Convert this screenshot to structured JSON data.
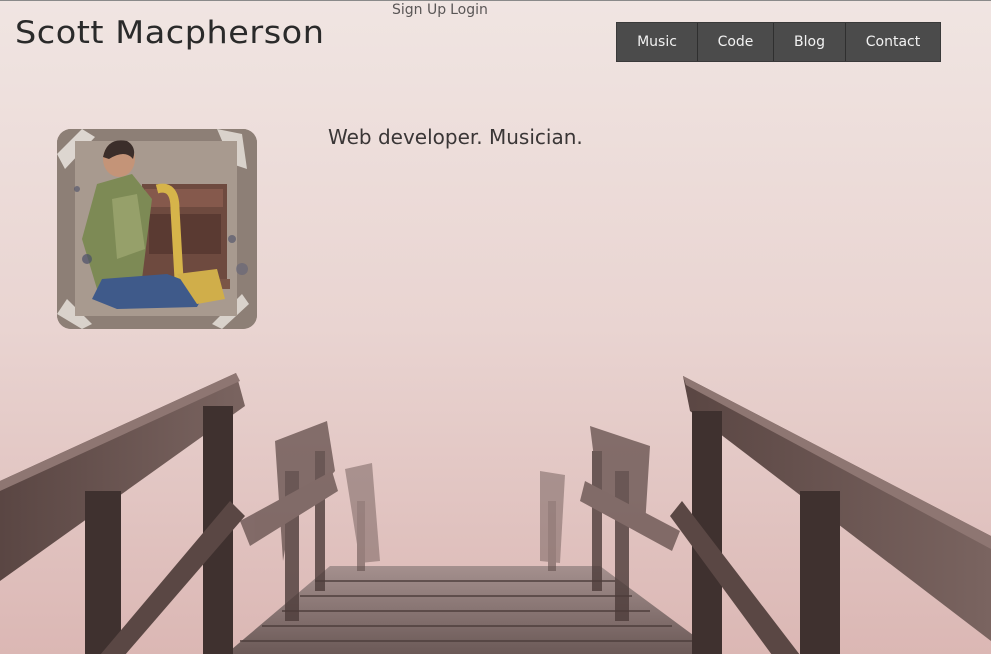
{
  "header": {
    "site_title": "Scott Macpherson",
    "auth": {
      "signup_label": "Sign Up",
      "login_label": "Login"
    }
  },
  "nav": {
    "items": [
      {
        "label": "Music"
      },
      {
        "label": "Code"
      },
      {
        "label": "Blog"
      },
      {
        "label": "Contact"
      }
    ]
  },
  "main": {
    "tagline": "Web developer. Musician."
  },
  "colors": {
    "nav_background": "#4b4b4b",
    "nav_text": "#f2f2f2",
    "title_text": "#2a2a2a",
    "background_fog": "#e8d4d1",
    "railing_wood": "#4e3e3b"
  }
}
